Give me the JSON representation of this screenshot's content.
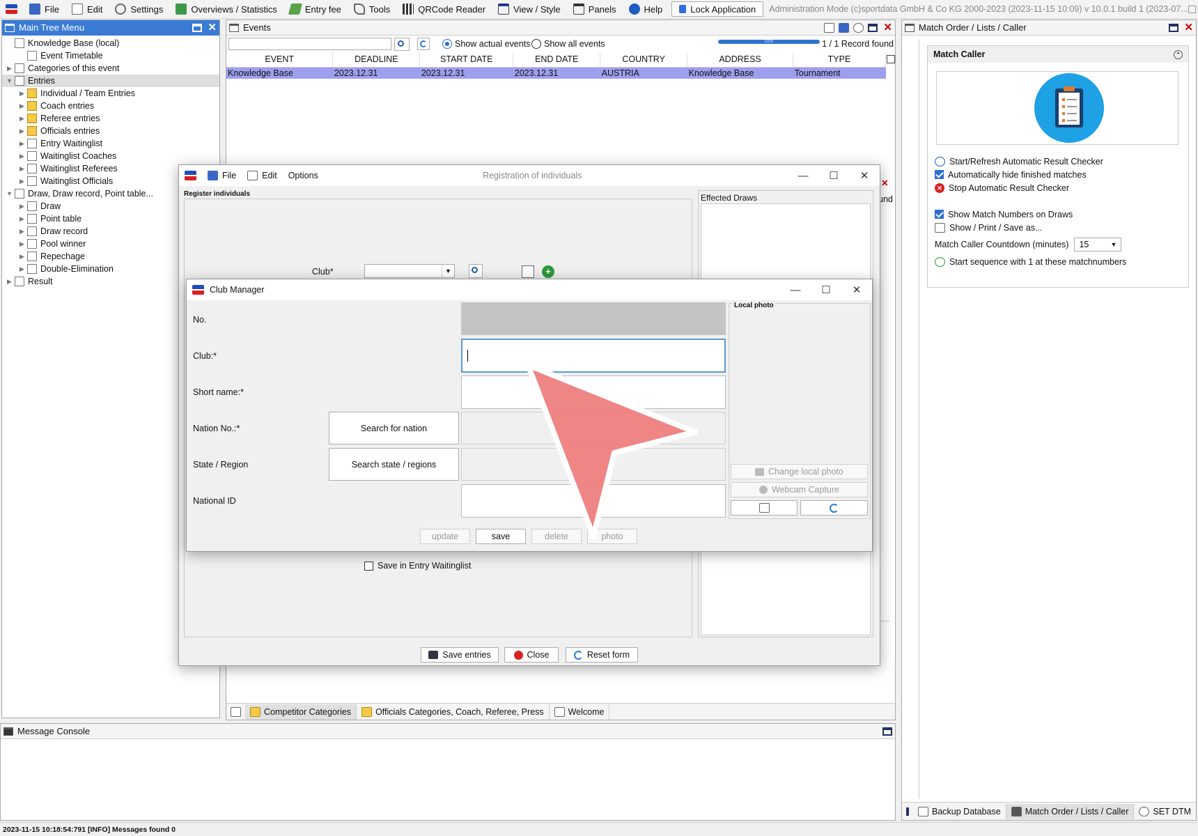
{
  "menubar": {
    "items": [
      {
        "label": "File",
        "icon": "file-icon"
      },
      {
        "label": "Edit",
        "icon": "edit-icon"
      },
      {
        "label": "Settings",
        "icon": "gear-icon"
      },
      {
        "label": "Overviews / Statistics",
        "icon": "statistics-icon"
      },
      {
        "label": "Entry fee",
        "icon": "money-icon"
      },
      {
        "label": "Tools",
        "icon": "wrench-icon"
      },
      {
        "label": "QRCode Reader",
        "icon": "qrcode-icon"
      },
      {
        "label": "View / Style",
        "icon": "view-icon"
      },
      {
        "label": "Panels",
        "icon": "panels-icon"
      },
      {
        "label": "Help",
        "icon": "help-icon"
      }
    ],
    "lock_label": "Lock Application",
    "admin_text": "Administration Mode (c)sportdata GmbH & Co KG 2000-2023 (2023-11-15 10:09)  v 10.0.1 build 1 (2023-07..."
  },
  "tree_panel": {
    "title": "Main Tree Menu",
    "items": [
      {
        "label": "Knowledge Base (local)",
        "level": 0,
        "expander": "",
        "icon": "database-icon"
      },
      {
        "label": "Event Timetable",
        "level": 1,
        "expander": "",
        "icon": "clock-icon"
      },
      {
        "label": "Categories of this event",
        "level": 0,
        "expander": "▶",
        "icon": "categories-icon"
      },
      {
        "label": "Entries",
        "level": 0,
        "expander": "▼",
        "icon": "entries-icon",
        "selected": true
      },
      {
        "label": "Individual / Team Entries",
        "level": 1,
        "expander": "▶",
        "icon": "folder-icon"
      },
      {
        "label": "Coach entries",
        "level": 1,
        "expander": "▶",
        "icon": "folder-icon"
      },
      {
        "label": "Referee entries",
        "level": 1,
        "expander": "▶",
        "icon": "folder-icon"
      },
      {
        "label": "Officials entries",
        "level": 1,
        "expander": "▶",
        "icon": "folder-icon"
      },
      {
        "label": "Entry Waitinglist",
        "level": 1,
        "expander": "▶",
        "icon": "waitinglist-icon"
      },
      {
        "label": "Waitinglist Coaches",
        "level": 1,
        "expander": "▶",
        "icon": "waitinglist-icon"
      },
      {
        "label": "Waitinglist Referees",
        "level": 1,
        "expander": "▶",
        "icon": "waitinglist-icon"
      },
      {
        "label": "Waitinglist Officials",
        "level": 1,
        "expander": "▶",
        "icon": "waitinglist-icon"
      },
      {
        "label": "Draw, Draw record, Point table...",
        "level": 0,
        "expander": "▼",
        "icon": "draw-icon"
      },
      {
        "label": "Draw",
        "level": 1,
        "expander": "▶",
        "icon": "draw-icon"
      },
      {
        "label": "Point table",
        "level": 1,
        "expander": "▶",
        "icon": "list-icon"
      },
      {
        "label": "Draw record",
        "level": 1,
        "expander": "▶",
        "icon": "record-icon"
      },
      {
        "label": "Pool winner",
        "level": 1,
        "expander": "▶",
        "icon": "pool-icon"
      },
      {
        "label": "Repechage",
        "level": 1,
        "expander": "▶",
        "icon": "repechage-icon"
      },
      {
        "label": "Double-Elimination",
        "level": 1,
        "expander": "▶",
        "icon": "elimination-icon"
      },
      {
        "label": "Result",
        "level": 0,
        "expander": "▶",
        "icon": "result-icon"
      }
    ]
  },
  "events_panel": {
    "title": "Events",
    "search_value": "",
    "radio_actual": "Show actual events",
    "radio_all": "Show all events",
    "progress_label": "100%",
    "progress": 1.0,
    "record_count": "1 / 1 Record found",
    "columns": [
      "EVENT",
      "DEADLINE",
      "START DATE",
      "END DATE",
      "COUNTRY",
      "ADDRESS",
      "TYPE"
    ],
    "rows": [
      [
        "Knowledge Base",
        "2023.12.31",
        "2023.12.31",
        "2023.12.31",
        "AUSTRIA",
        "Knowledge Base",
        "Tournament"
      ]
    ],
    "bottom_tabs": [
      {
        "label": "Competitor Categories",
        "active": true
      },
      {
        "label": "Officials Categories, Coach, Referee, Press",
        "active": false
      },
      {
        "label": "Welcome",
        "active": false
      }
    ],
    "behind_text_1": "und"
  },
  "console": {
    "title": "Message Console"
  },
  "status_bar": {
    "text": "2023-11-15 10:18:54:791 [INFO] Messages found 0"
  },
  "right_panel": {
    "title": "Match Order / Lists / Caller",
    "section_title": "Match Caller",
    "items": [
      {
        "label": "Start/Refresh Automatic Result Checker",
        "kind": "icon",
        "icon": "search-refresh-icon"
      },
      {
        "label": "Automatically hide finished matches",
        "kind": "check",
        "checked": true
      },
      {
        "label": "Stop Automatic Result Checker",
        "kind": "icon",
        "icon": "stop-icon"
      },
      {
        "label": "Show Match Numbers on Draws",
        "kind": "check",
        "checked": true
      },
      {
        "label": "Show / Print / Save as...",
        "kind": "icon",
        "icon": "print-icon"
      }
    ],
    "countdown_label": "Match Caller Countdown (minutes)",
    "countdown_value": "15",
    "sequence_label": "Start sequence with 1 at these matchnumbers",
    "bottom_tabs": [
      {
        "label": "Backup Database",
        "active": false
      },
      {
        "label": "Match Order / Lists / Caller",
        "active": true
      },
      {
        "label": "SET DTM",
        "active": false
      }
    ]
  },
  "registration": {
    "menu": [
      "File",
      "Edit",
      "Options"
    ],
    "title": "Registration of individuals",
    "section": "Register individuals",
    "effected_draws": "Effected Draws",
    "club_label": "Club*",
    "waitinglist_label": "Save in Entry Waitinglist",
    "save_entries": "Save entries",
    "close": "Close",
    "reset": "Reset form"
  },
  "club_manager": {
    "title": "Club Manager",
    "fields": {
      "no": "No.",
      "club": "Club:*",
      "short_name": "Short name:*",
      "nation": "Nation No.:*",
      "state": "State / Region",
      "national_id": "National ID"
    },
    "values": {
      "no": "",
      "club": "",
      "short_name": "",
      "nation": "",
      "state": "",
      "national_id": ""
    },
    "search_nation": "Search for nation",
    "search_state": "Search state / regions",
    "local_photo": "Local photo",
    "change_photo": "Change local photo",
    "webcam": "Webcam Capture",
    "buttons": {
      "update": "update",
      "save": "save",
      "delete": "delete",
      "photo": "photo"
    }
  },
  "colors": {
    "accent": "#3a7bd5",
    "selection_row": "#9f9fef",
    "focus_border": "#5b9bd5",
    "pointer": "#ef8080"
  }
}
